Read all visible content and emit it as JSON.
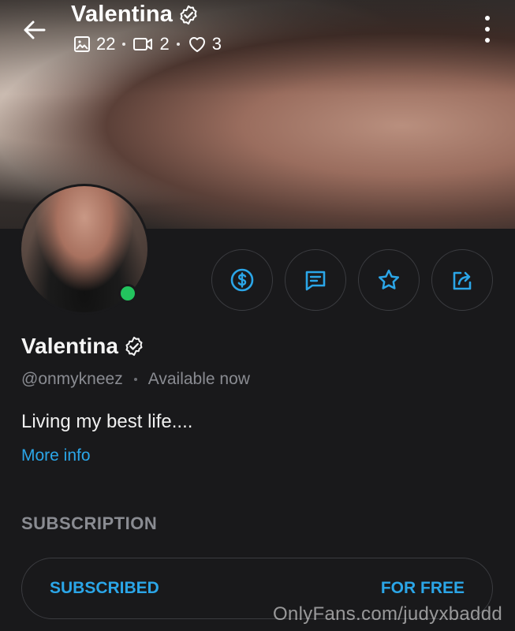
{
  "header": {
    "title": "Valentina",
    "stats": {
      "photos": "22",
      "videos": "2",
      "likes": "3"
    }
  },
  "profile": {
    "name": "Valentina",
    "handle": "@onmykneez",
    "status": "Available now",
    "bio": "Living my best life....",
    "more_info": "More info"
  },
  "actions": [
    {
      "icon": "dollar-icon"
    },
    {
      "icon": "message-icon"
    },
    {
      "icon": "star-icon"
    },
    {
      "icon": "share-icon"
    }
  ],
  "subscription": {
    "heading": "SUBSCRIPTION",
    "state": "SUBSCRIBED",
    "price": "FOR FREE"
  },
  "watermark": "OnlyFans.com/judyxbaddd",
  "colors": {
    "accent": "#2ba6e8",
    "online": "#23c45e",
    "background": "#19191b"
  }
}
